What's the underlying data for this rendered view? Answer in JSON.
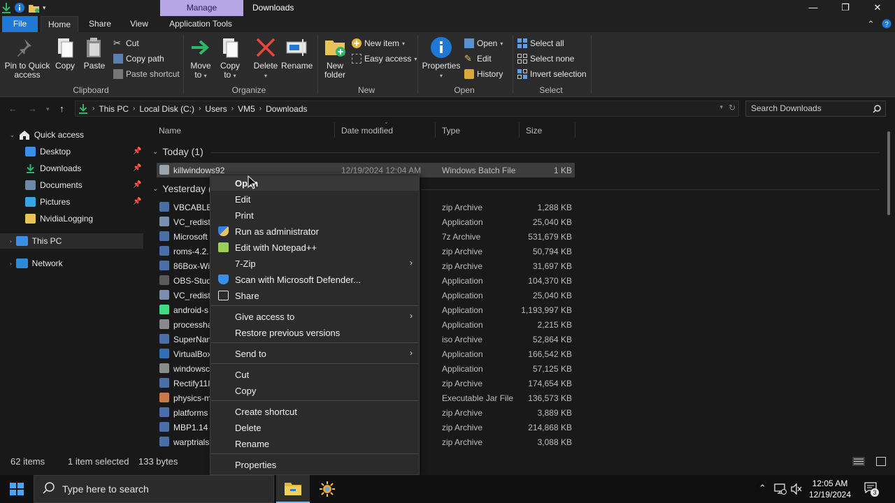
{
  "window": {
    "title": "Downloads",
    "manage_tab": "Manage",
    "controls": {
      "minimize": "—",
      "maximize": "❐",
      "close": "✕"
    }
  },
  "tabs": [
    {
      "label": "File"
    },
    {
      "label": "Home"
    },
    {
      "label": "Share"
    },
    {
      "label": "View"
    },
    {
      "label": "Application Tools"
    }
  ],
  "ribbon": {
    "clipboard": {
      "label": "Clipboard",
      "pin_line1": "Pin to Quick",
      "pin_line2": "access",
      "copy": "Copy",
      "paste": "Paste",
      "cut": "Cut",
      "copy_path": "Copy path",
      "paste_shortcut": "Paste shortcut"
    },
    "organize": {
      "label": "Organize",
      "move_to_line1": "Move",
      "move_to_line2": "to",
      "copy_to_line1": "Copy",
      "copy_to_line2": "to",
      "delete": "Delete",
      "rename": "Rename"
    },
    "new": {
      "label": "New",
      "new_folder_line1": "New",
      "new_folder_line2": "folder",
      "new_item": "New item",
      "easy_access": "Easy access"
    },
    "open": {
      "label": "Open",
      "properties": "Properties",
      "open": "Open",
      "edit": "Edit",
      "history": "History"
    },
    "select": {
      "label": "Select",
      "select_all": "Select all",
      "select_none": "Select none",
      "invert_selection": "Invert selection"
    }
  },
  "address": {
    "crumbs": [
      "This PC",
      "Local Disk (C:)",
      "Users",
      "VM5",
      "Downloads"
    ],
    "search_placeholder": "Search Downloads"
  },
  "nav": {
    "quick_access": "Quick access",
    "items": [
      {
        "label": "Desktop",
        "icon": "desktop-icon",
        "pinned": true
      },
      {
        "label": "Downloads",
        "icon": "downloads-icon",
        "pinned": true
      },
      {
        "label": "Documents",
        "icon": "documents-icon",
        "pinned": true
      },
      {
        "label": "Pictures",
        "icon": "pictures-icon",
        "pinned": true
      },
      {
        "label": "NvidiaLogging",
        "icon": "folder-icon",
        "pinned": false
      }
    ],
    "this_pc": "This PC",
    "network": "Network"
  },
  "columns": {
    "name": "Name",
    "date": "Date modified",
    "type": "Type",
    "size": "Size"
  },
  "groups": {
    "today": "Today (1)",
    "yesterday": "Yesterday ("
  },
  "files_today": [
    {
      "name": "killwindows92",
      "date": "12/19/2024 12:04 AM",
      "type": "Windows Batch File",
      "size": "1 KB",
      "icon": "batch-file-icon"
    }
  ],
  "files_yesterday": [
    {
      "name": "VBCABLE_",
      "type": "zip Archive",
      "size": "1,288 KB",
      "icon": "zip-icon"
    },
    {
      "name": "VC_redist.",
      "type": "Application",
      "size": "25,040 KB",
      "icon": "installer-icon"
    },
    {
      "name": "Microsoft",
      "type": "7z Archive",
      "size": "531,679 KB",
      "icon": "zip-icon"
    },
    {
      "name": "roms-4.2.",
      "type": "zip Archive",
      "size": "50,794 KB",
      "icon": "zip-icon"
    },
    {
      "name": "86Box-Wi",
      "type": "zip Archive",
      "size": "31,697 KB",
      "icon": "zip-icon"
    },
    {
      "name": "OBS-Stud",
      "type": "Application",
      "size": "104,370 KB",
      "icon": "obs-icon"
    },
    {
      "name": "VC_redist.",
      "type": "Application",
      "size": "25,040 KB",
      "icon": "installer-icon"
    },
    {
      "name": "android-s",
      "type": "Application",
      "size": "1,193,997 KB",
      "icon": "android-icon"
    },
    {
      "name": "processha",
      "type": "Application",
      "size": "2,215 KB",
      "icon": "app-icon"
    },
    {
      "name": "SuperNan",
      "type": "iso Archive",
      "size": "52,864 KB",
      "icon": "zip-icon"
    },
    {
      "name": "VirtualBox",
      "type": "Application",
      "size": "166,542 KB",
      "icon": "virtualbox-icon"
    },
    {
      "name": "windowsc",
      "type": "Application",
      "size": "57,125 KB",
      "icon": "app-icon"
    },
    {
      "name": "Rectify11I",
      "type": "zip Archive",
      "size": "174,654 KB",
      "icon": "zip-icon"
    },
    {
      "name": "physics-m",
      "type": "Executable Jar File",
      "size": "136,573 KB",
      "icon": "java-icon"
    },
    {
      "name": "platforms",
      "type": "zip Archive",
      "size": "3,889 KB",
      "icon": "zip-icon"
    },
    {
      "name": "MBP1.14",
      "type": "zip Archive",
      "size": "214,868 KB",
      "icon": "zip-icon"
    },
    {
      "name": "warptrials",
      "type": "zip Archive",
      "size": "3,088 KB",
      "icon": "zip-icon"
    }
  ],
  "context_menu": {
    "items": [
      {
        "label": "Open",
        "icon": "",
        "submenu": false,
        "bold": true
      },
      {
        "label": "Edit",
        "icon": "",
        "submenu": false
      },
      {
        "label": "Print",
        "icon": "",
        "submenu": false
      },
      {
        "label": "Run as administrator",
        "icon": "uac-shield-icon",
        "submenu": false
      },
      {
        "label": "Edit with Notepad++",
        "icon": "notepadpp-icon",
        "submenu": false
      },
      {
        "label": "7-Zip",
        "icon": "",
        "submenu": true
      },
      {
        "label": "Scan with Microsoft Defender...",
        "icon": "defender-icon",
        "submenu": false
      },
      {
        "label": "Share",
        "icon": "share-icon",
        "submenu": false
      },
      {
        "label": "Give access to",
        "icon": "",
        "submenu": true
      },
      {
        "label": "Restore previous versions",
        "icon": "",
        "submenu": false
      },
      {
        "label": "Send to",
        "icon": "",
        "submenu": true
      },
      {
        "label": "Cut",
        "icon": "",
        "submenu": false
      },
      {
        "label": "Copy",
        "icon": "",
        "submenu": false
      },
      {
        "label": "Create shortcut",
        "icon": "",
        "submenu": false
      },
      {
        "label": "Delete",
        "icon": "",
        "submenu": false
      },
      {
        "label": "Rename",
        "icon": "",
        "submenu": false
      },
      {
        "label": "Properties",
        "icon": "",
        "submenu": false
      }
    ]
  },
  "status": {
    "items_count": "62 items",
    "selected": "1 item selected",
    "size": "133 bytes"
  },
  "taskbar": {
    "search_placeholder": "Type here to search",
    "time": "12:05 AM",
    "date": "12/19/2024",
    "notifications": "3"
  },
  "colors": {
    "accent": "#1e78d6",
    "manage": "#b7a6e6",
    "background": "#191919",
    "ribbon": "#2b2b2b"
  }
}
